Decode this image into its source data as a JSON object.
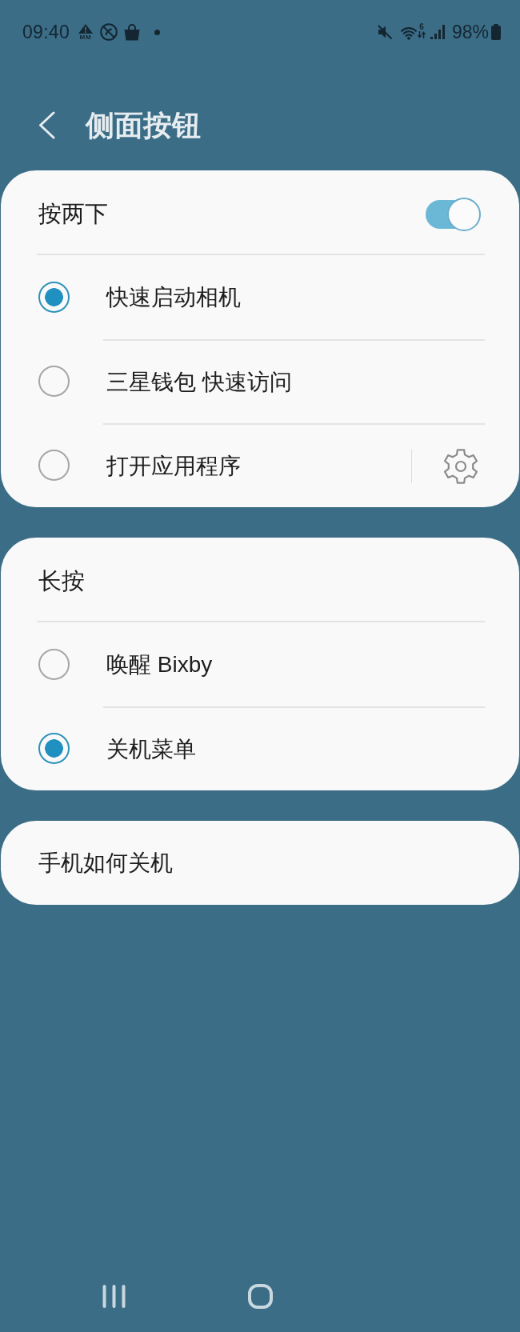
{
  "status_bar": {
    "time": "09:40",
    "alert_label": "MM",
    "wifi_label": "6",
    "battery": "98%"
  },
  "header": {
    "title": "侧面按钮"
  },
  "sections": [
    {
      "kind": "switch_group",
      "title": "按两下",
      "on": true,
      "options": [
        {
          "kind": "radio",
          "label": "快速启动相机",
          "selected": true
        },
        {
          "kind": "radio",
          "label": "三星钱包 快速访问",
          "selected": false
        },
        {
          "kind": "radio_with_settings",
          "label": "打开应用程序",
          "selected": false
        }
      ]
    },
    {
      "kind": "group",
      "title": "长按",
      "options": [
        {
          "kind": "radio",
          "label": "唤醒 Bixby",
          "selected": false
        },
        {
          "kind": "radio",
          "label": "关机菜单",
          "selected": true
        }
      ]
    },
    {
      "kind": "link",
      "title": "手机如何关机"
    }
  ]
}
